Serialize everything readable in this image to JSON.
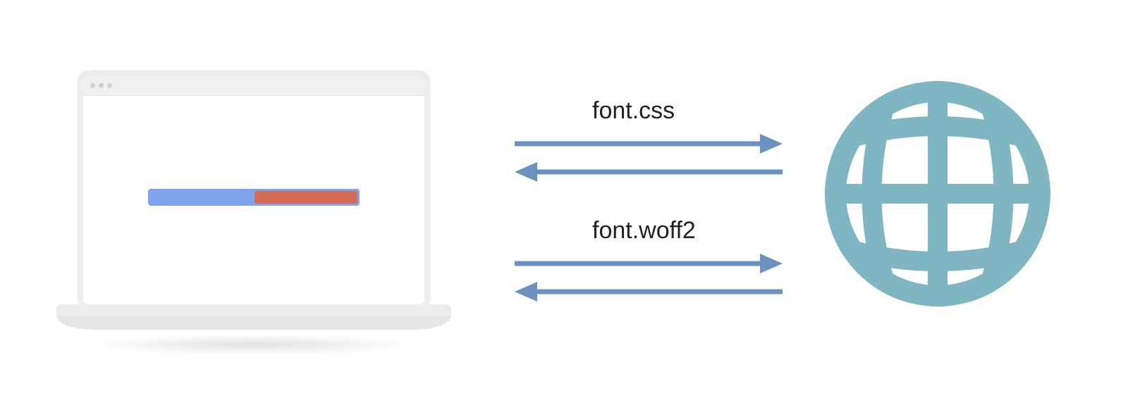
{
  "requests": {
    "css_file": "font.css",
    "font_file": "font.woff2"
  },
  "colors": {
    "arrow": "#6b92bf",
    "globe": "#7fb6c1",
    "progress_blue": "#7fa4ed",
    "progress_red": "#d56b54",
    "device_frame": "#ededed"
  }
}
